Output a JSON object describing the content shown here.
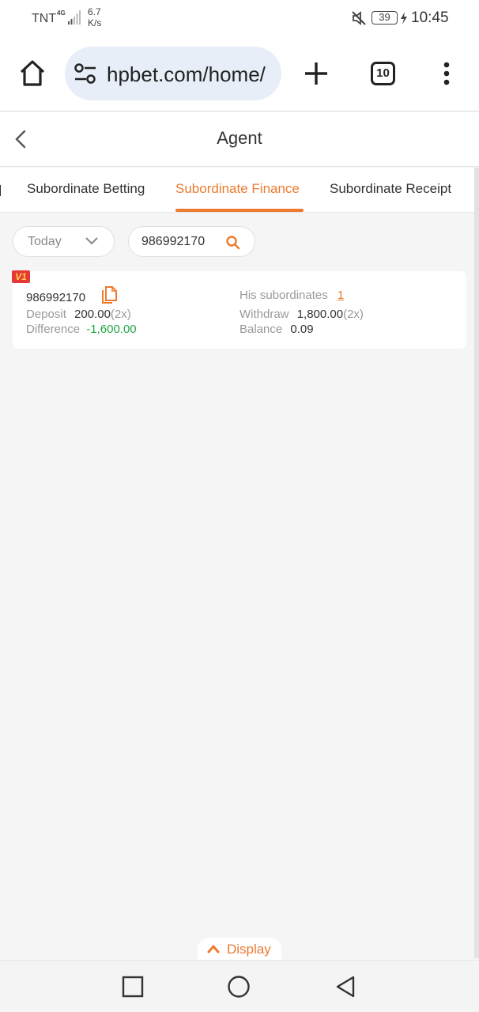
{
  "status_bar": {
    "carrier": "TNT",
    "network": "4G",
    "speed": "6.7 K/s",
    "battery": "39",
    "time": "10:45"
  },
  "browser": {
    "url": "hpbet.com/home/",
    "tab_count": "10"
  },
  "header": {
    "title": "Agent"
  },
  "tabs": [
    {
      "label": "Subordinate Betting",
      "active": false
    },
    {
      "label": "Subordinate Finance",
      "active": true
    },
    {
      "label": "Subordinate Receipt",
      "active": false
    }
  ],
  "filters": {
    "date": "Today",
    "search_value": "986992170"
  },
  "record": {
    "level_badge": "V1",
    "user_id": "986992170",
    "subordinates_label": "His subordinates",
    "subordinates_value": "1",
    "deposit_label": "Deposit",
    "deposit_value": "200.00",
    "deposit_count": "(2x)",
    "withdraw_label": "Withdraw",
    "withdraw_value": "1,800.00",
    "withdraw_count": "(2x)",
    "difference_label": "Difference",
    "difference_value": "-1,600.00",
    "balance_label": "Balance",
    "balance_value": "0.09"
  },
  "display_button": {
    "label": "Display"
  },
  "colors": {
    "accent": "#ee7a30",
    "negative": "#22a845",
    "badge": "#e53935"
  }
}
